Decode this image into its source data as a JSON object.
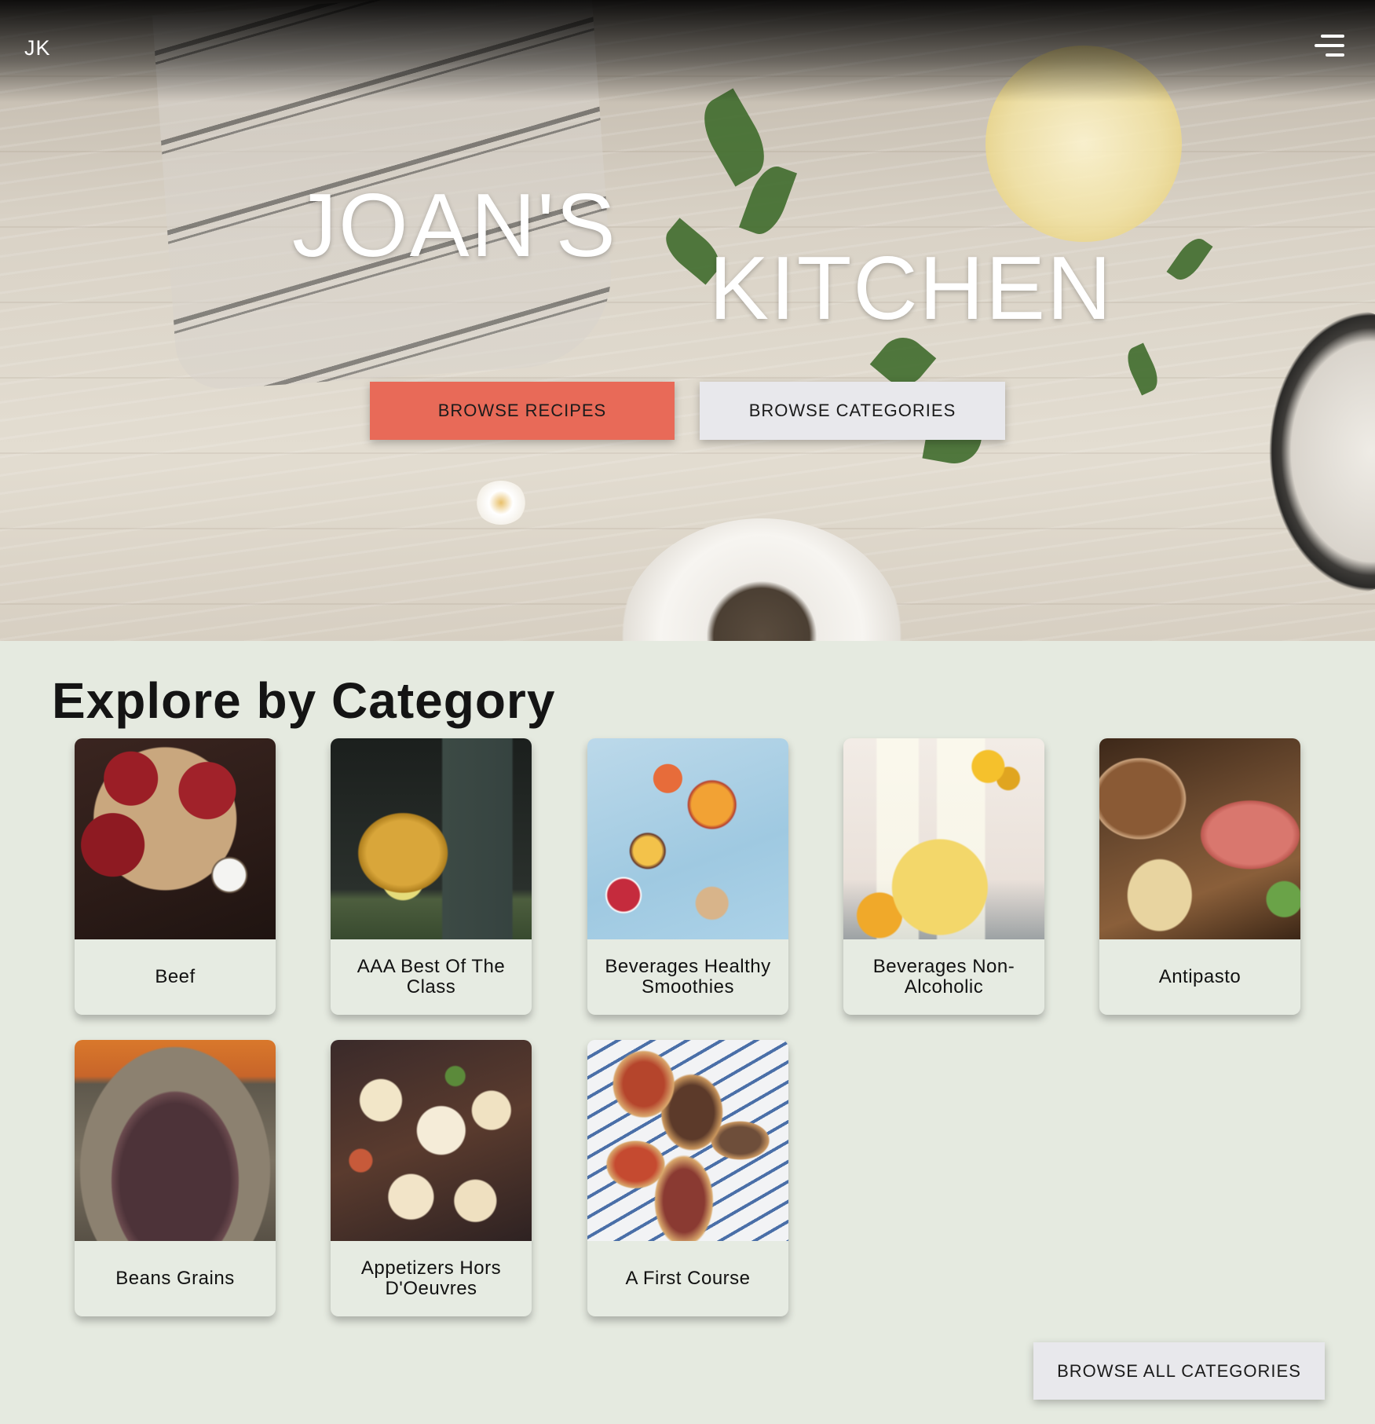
{
  "header": {
    "logo": "JK",
    "menu_icon": "menu-icon"
  },
  "hero": {
    "title_line_1": "JOAN'S",
    "title_line_2": "KITCHEN",
    "browse_recipes_label": "BROWSE RECIPES",
    "browse_categories_label": "BROWSE CATEGORIES",
    "colors": {
      "primary_button": "#e86a58",
      "secondary_button": "#e8e8ec"
    }
  },
  "section": {
    "title": "Explore by Category",
    "background": "#e5eae0",
    "categories": [
      {
        "label": "Beef",
        "image": "beef-photo"
      },
      {
        "label": "AAA Best Of The Class",
        "image": "honey-jar-photo"
      },
      {
        "label": "Beverages Healthy Smoothies",
        "image": "smoothie-photo"
      },
      {
        "label": "Beverages Non-Alcoholic",
        "image": "lemonade-photo"
      },
      {
        "label": "Antipasto",
        "image": "antipasto-photo"
      },
      {
        "label": "Beans Grains",
        "image": "beans-photo"
      },
      {
        "label": "Appetizers Hors D'Oeuvres",
        "image": "appetizers-photo"
      },
      {
        "label": "A First Course",
        "image": "bruschetta-photo"
      }
    ],
    "browse_all_label": "BROWSE ALL CATEGORIES"
  }
}
